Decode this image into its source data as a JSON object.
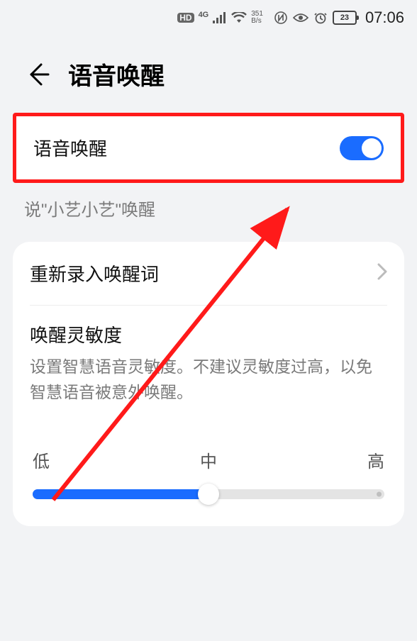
{
  "status_bar": {
    "hd": "HD",
    "net_gen": "4G",
    "net_speed_value": "351",
    "net_speed_unit": "B/s",
    "battery": "23",
    "time": "07:06"
  },
  "header": {
    "title": "语音唤醒"
  },
  "voice_wake": {
    "label": "语音唤醒",
    "toggle_on": true,
    "hint": "说\"小艺小艺\"唤醒"
  },
  "retrain": {
    "label": "重新录入唤醒词"
  },
  "sensitivity": {
    "title": "唤醒灵敏度",
    "desc": "设置智慧语音灵敏度。不建议灵敏度过高，以免智慧语音被意外唤醒。",
    "labels": {
      "low": "低",
      "mid": "中",
      "high": "高"
    },
    "value_percent": 50
  }
}
